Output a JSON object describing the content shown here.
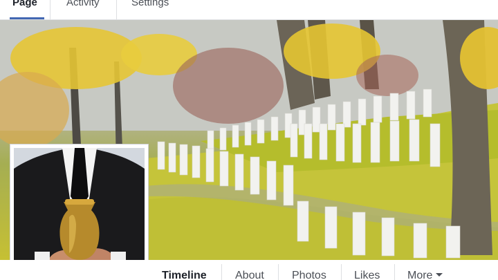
{
  "admin_tabs": [
    {
      "label": "Page",
      "active": true
    },
    {
      "label": "Activity",
      "active": false
    },
    {
      "label": "Settings",
      "active": false
    }
  ],
  "page_nav": [
    {
      "label": "Timeline",
      "active": true
    },
    {
      "label": "About",
      "active": false
    },
    {
      "label": "Photos",
      "active": false
    },
    {
      "label": "Likes",
      "active": false
    },
    {
      "label": "More",
      "active": false
    }
  ],
  "icons": {
    "more_caret": "caret-down-icon"
  },
  "colors": {
    "accent": "#4267b2",
    "foliage": "#e2c63a",
    "grass": "#b8c12e"
  }
}
